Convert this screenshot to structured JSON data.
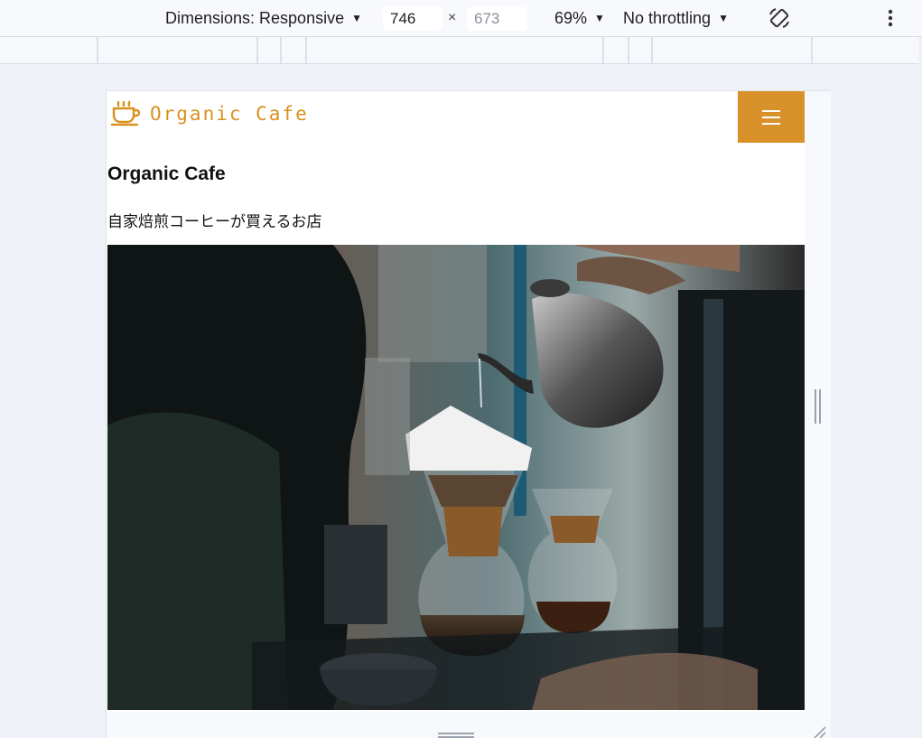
{
  "toolbar": {
    "dimensions_label": "Dimensions: Responsive",
    "width_value": "746",
    "height_placeholder": "673",
    "times_symbol": "×",
    "zoom_label": "69%",
    "throttling_label": "No throttling",
    "rotate_icon": "rotate-icon",
    "more_icon": "more-vert-icon"
  },
  "site": {
    "logo_text": "Organic Cafe",
    "logo_icon": "coffee-cup-icon",
    "menu_icon": "hamburger-icon",
    "hero_title": "Organic Cafe",
    "hero_subtitle": "自家焙煎コーヒーが買えるお店",
    "photo_icon": "coffee-pour-over-photo"
  },
  "colors": {
    "accent": "#d9922a",
    "logo": "#d8911f",
    "toolbar_bg": "#f8f9fd",
    "page_bg": "#eef1f7"
  }
}
